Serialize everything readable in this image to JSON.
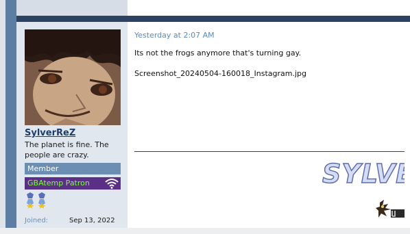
{
  "post": {
    "date": "Yesterday at 2:07 AM",
    "message": "Its not the frogs anymore that's turning gay.",
    "attachment_name": "Screenshot_20240504-160018_Instagram.jpg",
    "signature_text": "SYLVE"
  },
  "user": {
    "username": "SylverReZ",
    "custom_title": "The planet is fine. The people are crazy.",
    "role": "Member",
    "patron_badge": "GBAtemp Patron",
    "joined_label": "Joined:",
    "joined_date": "Sep 13, 2022"
  },
  "colors": {
    "border": "#5d7ea3",
    "divider": "#2b4263",
    "sidebar_bg": "#e1e7ef",
    "member_badge": "#6c8eb3",
    "patron_bg": "#5a2f86",
    "patron_text": "#7dff3b",
    "date_text": "#5d8ab9"
  },
  "icons": {
    "patron": "wifi-icon",
    "trophies": "trophy-icon"
  }
}
